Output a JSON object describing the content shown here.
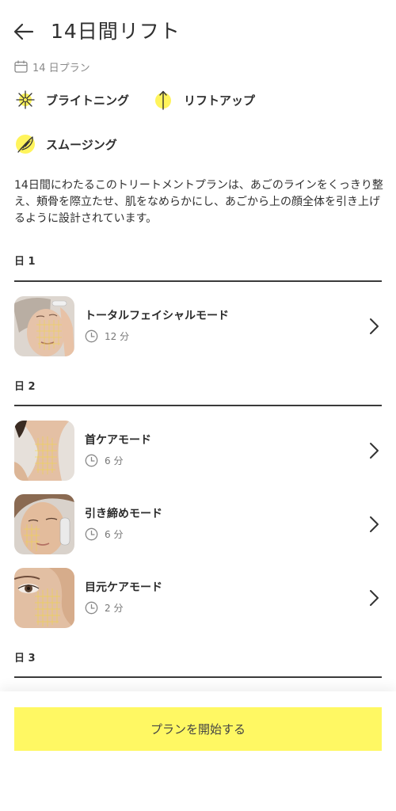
{
  "header": {
    "title": "14日間リフト"
  },
  "plan_meta": {
    "label": "14 日プラン"
  },
  "benefits": [
    {
      "label": "ブライトニング",
      "icon": "sparkle-icon"
    },
    {
      "label": "リフトアップ",
      "icon": "arrow-up-icon"
    },
    {
      "label": "スムージング",
      "icon": "feather-icon"
    }
  ],
  "description": "14日間にわたるこのトリートメントプランは、あごのラインをくっきり整え、頬骨を際立たせ、肌をなめらかにし、あごから上の顔全体を引き上げるように設計されています。",
  "days": [
    {
      "label": "日 1",
      "sessions": [
        {
          "title": "トータルフェイシャルモード",
          "duration": "12 分"
        }
      ]
    },
    {
      "label": "日 2",
      "sessions": [
        {
          "title": "首ケアモード",
          "duration": "6 分"
        },
        {
          "title": "引き締めモード",
          "duration": "6 分"
        },
        {
          "title": "目元ケアモード",
          "duration": "2 分"
        }
      ]
    },
    {
      "label": "日 3",
      "sessions": []
    }
  ],
  "cta": {
    "label": "プランを開始する"
  },
  "colors": {
    "accent": "#fff863",
    "icon_fill": "#fff45c",
    "text": "#2b2b2b",
    "muted": "#8a8a8a"
  }
}
